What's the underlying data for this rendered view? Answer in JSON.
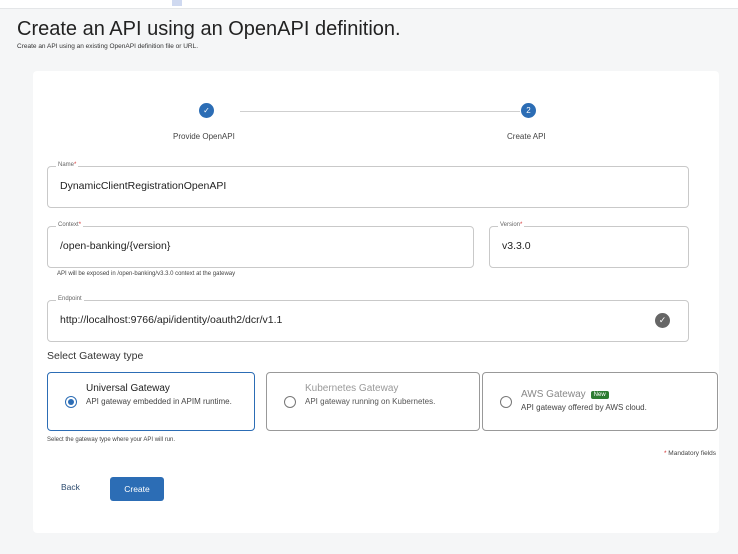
{
  "header": {
    "title": "Create an API using an OpenAPI definition.",
    "subtitle": "Create an API using an existing OpenAPI definition file or URL."
  },
  "stepper": {
    "steps": [
      {
        "label": "Provide OpenAPI",
        "marker": "✓",
        "status": "completed"
      },
      {
        "label": "Create API",
        "marker": "2",
        "status": "active"
      }
    ]
  },
  "form": {
    "name": {
      "label": "Name",
      "required_mark": "*",
      "value": "DynamicClientRegistrationOpenAPI"
    },
    "context": {
      "label": "Context",
      "required_mark": "*",
      "value": "/open-banking/{version}",
      "helper": "API will be exposed in /open-banking/v3.3.0 context at the gateway"
    },
    "version": {
      "label": "Version",
      "required_mark": "*",
      "value": "v3.3.0"
    },
    "endpoint": {
      "label": "Endpoint",
      "value": "http://localhost:9766/api/identity/oauth2/dcr/v1.1",
      "valid_icon": "check-circle-icon"
    }
  },
  "gateway": {
    "section_label": "Select Gateway type",
    "options": [
      {
        "title": "Universal Gateway",
        "description": "API gateway embedded in APIM runtime.",
        "selected": true,
        "enabled": true
      },
      {
        "title": "Kubernetes Gateway",
        "description": "API gateway running on Kubernetes.",
        "selected": false,
        "enabled": false
      },
      {
        "title": "AWS Gateway",
        "badge": "New",
        "description": "API gateway offered by AWS cloud.",
        "selected": false,
        "enabled": true
      }
    ],
    "helper": "Select the gateway type where your API will run."
  },
  "footer": {
    "mandatory_mark": "*",
    "mandatory_text": "Mandatory fields",
    "back_label": "Back",
    "create_label": "Create"
  },
  "colors": {
    "primary": "#2c6db5",
    "required": "#d32f2f",
    "badge_new": "#2e7d32"
  }
}
